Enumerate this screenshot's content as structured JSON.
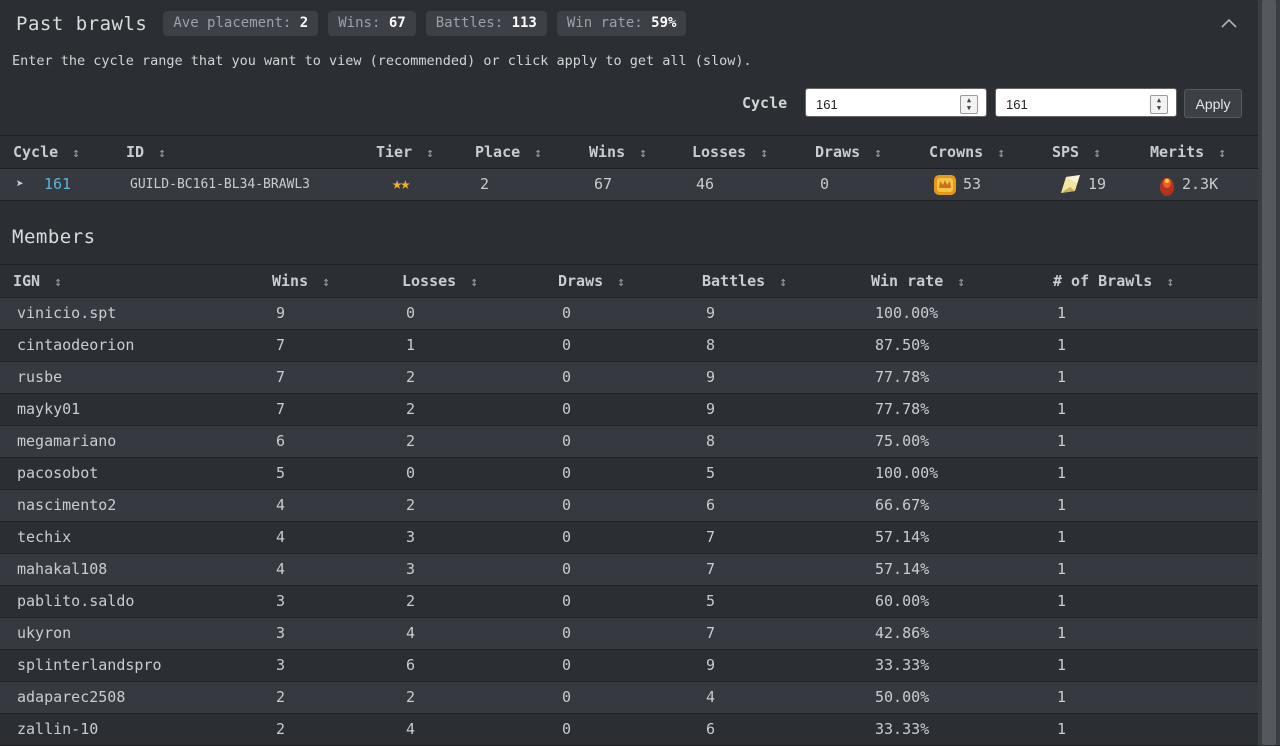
{
  "header": {
    "title": "Past brawls",
    "badges": [
      {
        "label": "Ave placement:",
        "value": "2"
      },
      {
        "label": "Wins:",
        "value": "67"
      },
      {
        "label": "Battles:",
        "value": "113"
      },
      {
        "label": "Win rate:",
        "value": "59%"
      }
    ],
    "collapse_icon": "chevron-up-icon"
  },
  "hint": "Enter the cycle range that you want to view (recommended) or click apply to get all (slow).",
  "cycle_filter": {
    "label": "Cycle",
    "from": "161",
    "to": "161",
    "apply_label": "Apply"
  },
  "brawls": {
    "columns": [
      "Cycle",
      "ID",
      "Tier",
      "Place",
      "Wins",
      "Losses",
      "Draws",
      "Crowns",
      "SPS",
      "Merits"
    ],
    "sort_icon": "↕",
    "rows": [
      {
        "expand_icon": "➤",
        "cycle": "161",
        "id": "GUILD-BC161-BL34-BRAWL3",
        "tier": "★★",
        "place": "2",
        "wins": "67",
        "losses": "46",
        "draws": "0",
        "crowns": "53",
        "sps": "19",
        "merits": "2.3K"
      }
    ]
  },
  "members": {
    "title": "Members",
    "columns": [
      "IGN",
      "Wins",
      "Losses",
      "Draws",
      "Battles",
      "Win rate",
      "# of Brawls"
    ],
    "rows": [
      {
        "ign": "vinicio.spt",
        "wins": "9",
        "losses": "0",
        "draws": "0",
        "battles": "9",
        "win_rate": "100.00%",
        "brawls": "1"
      },
      {
        "ign": "cintaodeorion",
        "wins": "7",
        "losses": "1",
        "draws": "0",
        "battles": "8",
        "win_rate": "87.50%",
        "brawls": "1"
      },
      {
        "ign": "rusbe",
        "wins": "7",
        "losses": "2",
        "draws": "0",
        "battles": "9",
        "win_rate": "77.78%",
        "brawls": "1"
      },
      {
        "ign": "mayky01",
        "wins": "7",
        "losses": "2",
        "draws": "0",
        "battles": "9",
        "win_rate": "77.78%",
        "brawls": "1"
      },
      {
        "ign": "megamariano",
        "wins": "6",
        "losses": "2",
        "draws": "0",
        "battles": "8",
        "win_rate": "75.00%",
        "brawls": "1"
      },
      {
        "ign": "pacosobot",
        "wins": "5",
        "losses": "0",
        "draws": "0",
        "battles": "5",
        "win_rate": "100.00%",
        "brawls": "1"
      },
      {
        "ign": "nascimento2",
        "wins": "4",
        "losses": "2",
        "draws": "0",
        "battles": "6",
        "win_rate": "66.67%",
        "brawls": "1"
      },
      {
        "ign": "techix",
        "wins": "4",
        "losses": "3",
        "draws": "0",
        "battles": "7",
        "win_rate": "57.14%",
        "brawls": "1"
      },
      {
        "ign": "mahakal108",
        "wins": "4",
        "losses": "3",
        "draws": "0",
        "battles": "7",
        "win_rate": "57.14%",
        "brawls": "1"
      },
      {
        "ign": "pablito.saldo",
        "wins": "3",
        "losses": "2",
        "draws": "0",
        "battles": "5",
        "win_rate": "60.00%",
        "brawls": "1"
      },
      {
        "ign": "ukyron",
        "wins": "3",
        "losses": "4",
        "draws": "0",
        "battles": "7",
        "win_rate": "42.86%",
        "brawls": "1"
      },
      {
        "ign": "splinterlandspro",
        "wins": "3",
        "losses": "6",
        "draws": "0",
        "battles": "9",
        "win_rate": "33.33%",
        "brawls": "1"
      },
      {
        "ign": "adaparec2508",
        "wins": "2",
        "losses": "2",
        "draws": "0",
        "battles": "4",
        "win_rate": "50.00%",
        "brawls": "1"
      },
      {
        "ign": "zallin-10",
        "wins": "2",
        "losses": "4",
        "draws": "0",
        "battles": "6",
        "win_rate": "33.33%",
        "brawls": "1"
      }
    ]
  },
  "colors": {
    "background": "#2b2e33",
    "row_alt": "#363a40",
    "link": "#5fb3d9",
    "star": "#f1b12a"
  }
}
